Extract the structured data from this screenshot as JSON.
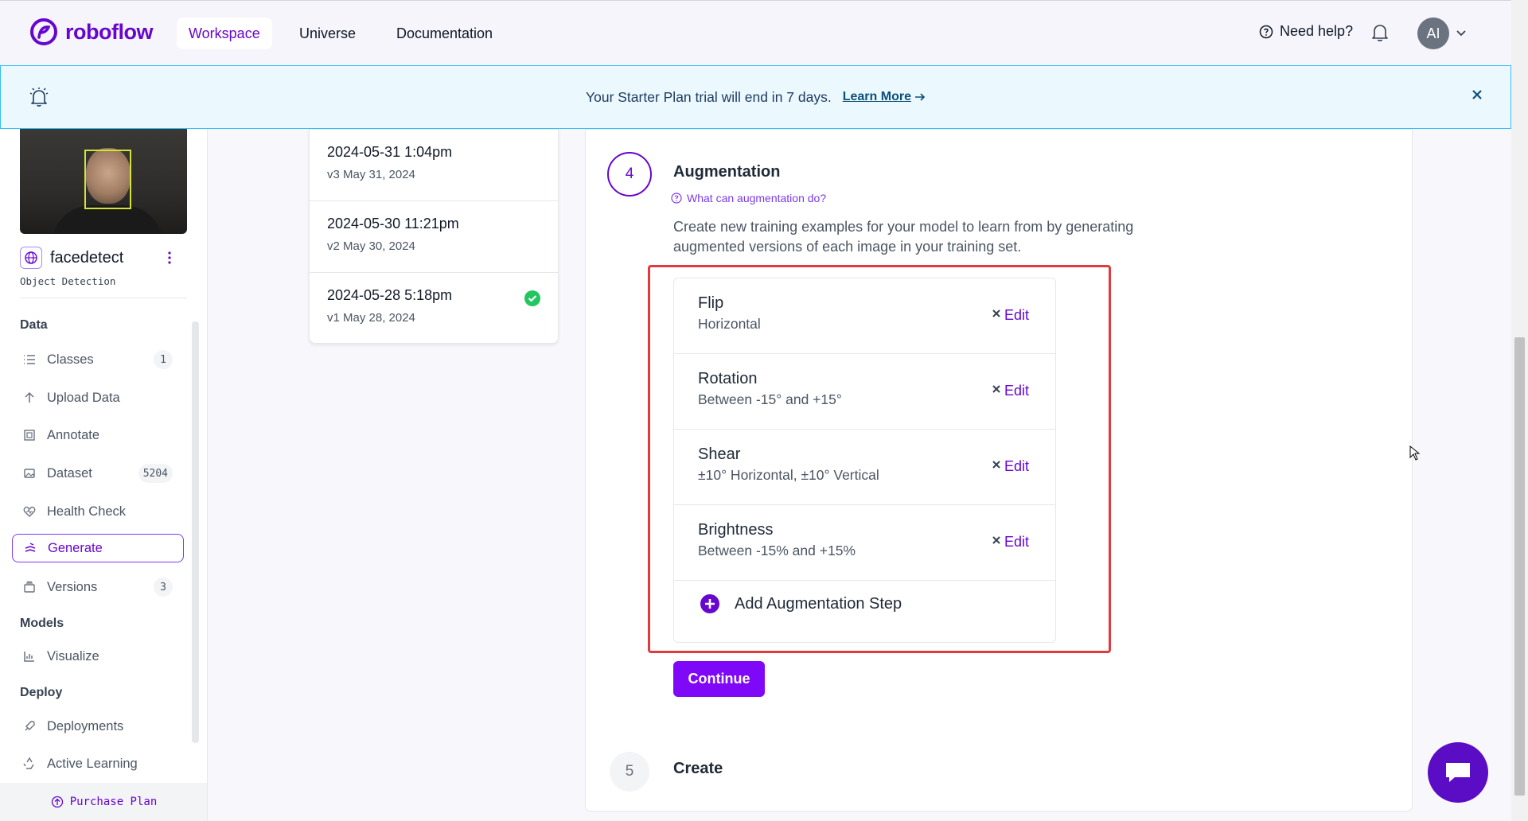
{
  "brand": {
    "name": "roboflow",
    "color": "#6706ce"
  },
  "nav": {
    "tabs": [
      {
        "label": "Workspace"
      },
      {
        "label": "Universe"
      },
      {
        "label": "Documentation"
      }
    ],
    "help": "Need help?",
    "avatar": "AI"
  },
  "banner": {
    "text": "Your Starter Plan trial will end in 7 days.",
    "link": "Learn More"
  },
  "project": {
    "name": "facedetect",
    "type": "Object Detection"
  },
  "sidebar": {
    "data_section": "Data",
    "data_items": [
      {
        "label": "Classes",
        "count": "1",
        "icon": "list-icon"
      },
      {
        "label": "Upload Data",
        "icon": "upload-icon"
      },
      {
        "label": "Annotate",
        "icon": "annotate-icon"
      },
      {
        "label": "Dataset",
        "count": "5204",
        "icon": "images-icon"
      },
      {
        "label": "Health Check",
        "icon": "heart-pulse-icon"
      },
      {
        "label": "Generate",
        "icon": "generate-icon"
      },
      {
        "label": "Versions",
        "count": "3",
        "icon": "versions-icon"
      }
    ],
    "models_section": "Models",
    "models_items": [
      {
        "label": "Visualize",
        "icon": "chart-icon"
      }
    ],
    "deploy_section": "Deploy",
    "deploy_items": [
      {
        "label": "Deployments",
        "icon": "rocket-icon"
      },
      {
        "label": "Active Learning",
        "icon": "recycle-icon"
      }
    ],
    "purchase": "Purchase Plan"
  },
  "versions": [
    {
      "title": "2024-05-31 1:04pm",
      "sub": "v3 May 31, 2024"
    },
    {
      "title": "2024-05-30 11:21pm",
      "sub": "v2 May 30, 2024"
    },
    {
      "title": "2024-05-28 5:18pm",
      "sub": "v1 May 28, 2024"
    }
  ],
  "steps": {
    "augmentation": {
      "number": "4",
      "title": "Augmentation",
      "help": "What can augmentation do?",
      "description": "Create new training examples for your model to learn from by generating augmented versions of each image in your training set.",
      "items": [
        {
          "name": "Flip",
          "detail": "Horizontal",
          "edit": "Edit"
        },
        {
          "name": "Rotation",
          "detail": "Between -15° and +15°",
          "edit": "Edit"
        },
        {
          "name": "Shear",
          "detail": "±10° Horizontal, ±10° Vertical",
          "edit": "Edit"
        },
        {
          "name": "Brightness",
          "detail": "Between -15% and +15%",
          "edit": "Edit"
        }
      ],
      "add_step": "Add Augmentation Step",
      "continue": "Continue"
    },
    "create": {
      "number": "5",
      "title": "Create"
    }
  },
  "colors": {
    "accent": "#6706ce",
    "button": "#7e08f7",
    "success": "#22c55e",
    "highlight_box": "#e0393e"
  }
}
